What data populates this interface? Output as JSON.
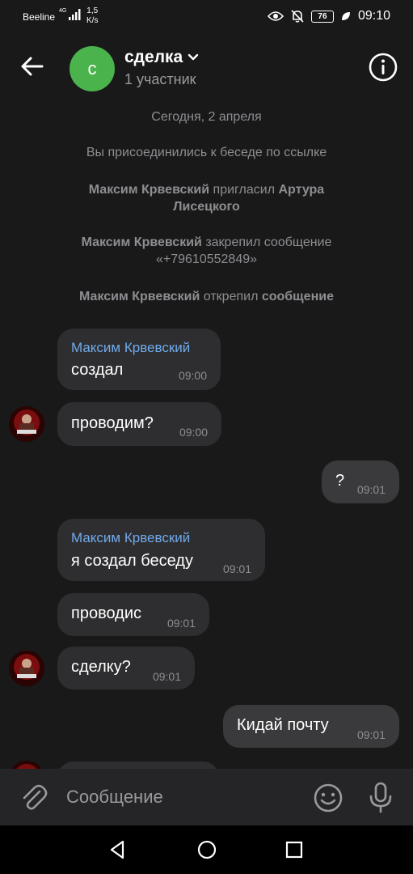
{
  "status_bar": {
    "carrier": "Beeline",
    "network": "4G",
    "speed_value": "1,5",
    "speed_unit": "K/s",
    "battery": "76",
    "time": "09:10"
  },
  "header": {
    "avatar_letter": "с",
    "title": "сделка",
    "subtitle": "1 участник"
  },
  "service_messages": {
    "date": "Сегодня, 2 апреля",
    "joined": "Вы присоединились к беседе по ссылке",
    "invite": {
      "actor": "Максим Крвевский",
      "action": " пригласил ",
      "target_line1": "Артура",
      "target_line2": "Лисецкого"
    },
    "pinned": {
      "actor": "Максим Крвевский",
      "action": " закрепил сообщение",
      "message": "«+79610552849»"
    },
    "unpinned": {
      "actor": "Максим Крвевский",
      "action": " открепил ",
      "target": "сообщение"
    }
  },
  "messages": [
    {
      "sender": "Максим Крвевский",
      "text": "создал",
      "time": "09:00",
      "direction": "in"
    },
    {
      "text": "проводим?",
      "time": "09:00",
      "direction": "in"
    },
    {
      "text": "?",
      "time": "09:01",
      "direction": "out"
    },
    {
      "sender": "Максим Крвевский",
      "text": "я создал беседу",
      "time": "09:01",
      "direction": "in"
    },
    {
      "text": "проводис",
      "time": "09:01",
      "direction": "in"
    },
    {
      "text": "сделку?",
      "time": "09:01",
      "direction": "in"
    },
    {
      "text": "Кидай почту",
      "time": "09:01",
      "direction": "out"
    }
  ],
  "composer": {
    "placeholder": "Сообщение"
  },
  "colors": {
    "background": "#19191a",
    "bubble": "#2e2e30",
    "accent_name": "#71aaeb",
    "avatar": "#4bb34b"
  }
}
